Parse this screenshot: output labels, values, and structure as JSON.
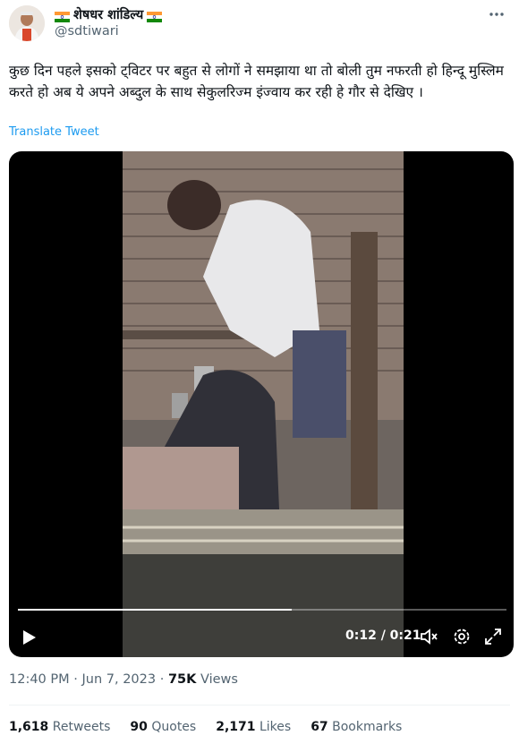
{
  "author": {
    "display_name": "शेषधर शांडिल्य",
    "handle": "@sdtiwari",
    "avatar_icon": "profile-photo"
  },
  "tweet": {
    "text": "कुछ दिन पहले इसको ट्विटर पर बहुत से लोगों ने समझाया था तो बोली तुम नफरती हो हिन्दू मुस्लिम करते हो अब ये अपने अब्दुल के साथ सेकुलरिज्म इंज्वाय कर रही हे गौर से देखिए ।",
    "translate_label": "Translate Tweet"
  },
  "video": {
    "time_display": "0:12 / 0:21",
    "progress": 0.56,
    "icons": [
      "play-icon",
      "mute-icon",
      "settings-icon",
      "fullscreen-icon"
    ]
  },
  "meta": {
    "time": "12:40 PM",
    "date": "Jun 7, 2023",
    "views_count": "75K",
    "views_label": "Views"
  },
  "stats": [
    {
      "count": "1,618",
      "label": "Retweets"
    },
    {
      "count": "90",
      "label": "Quotes"
    },
    {
      "count": "2,171",
      "label": "Likes"
    },
    {
      "count": "67",
      "label": "Bookmarks"
    }
  ],
  "colors": {
    "link": "#1d9bf0",
    "secondary_text": "#536471",
    "primary_text": "#0f1419",
    "flag_saffron": "#ff9933",
    "flag_green": "#138808"
  }
}
